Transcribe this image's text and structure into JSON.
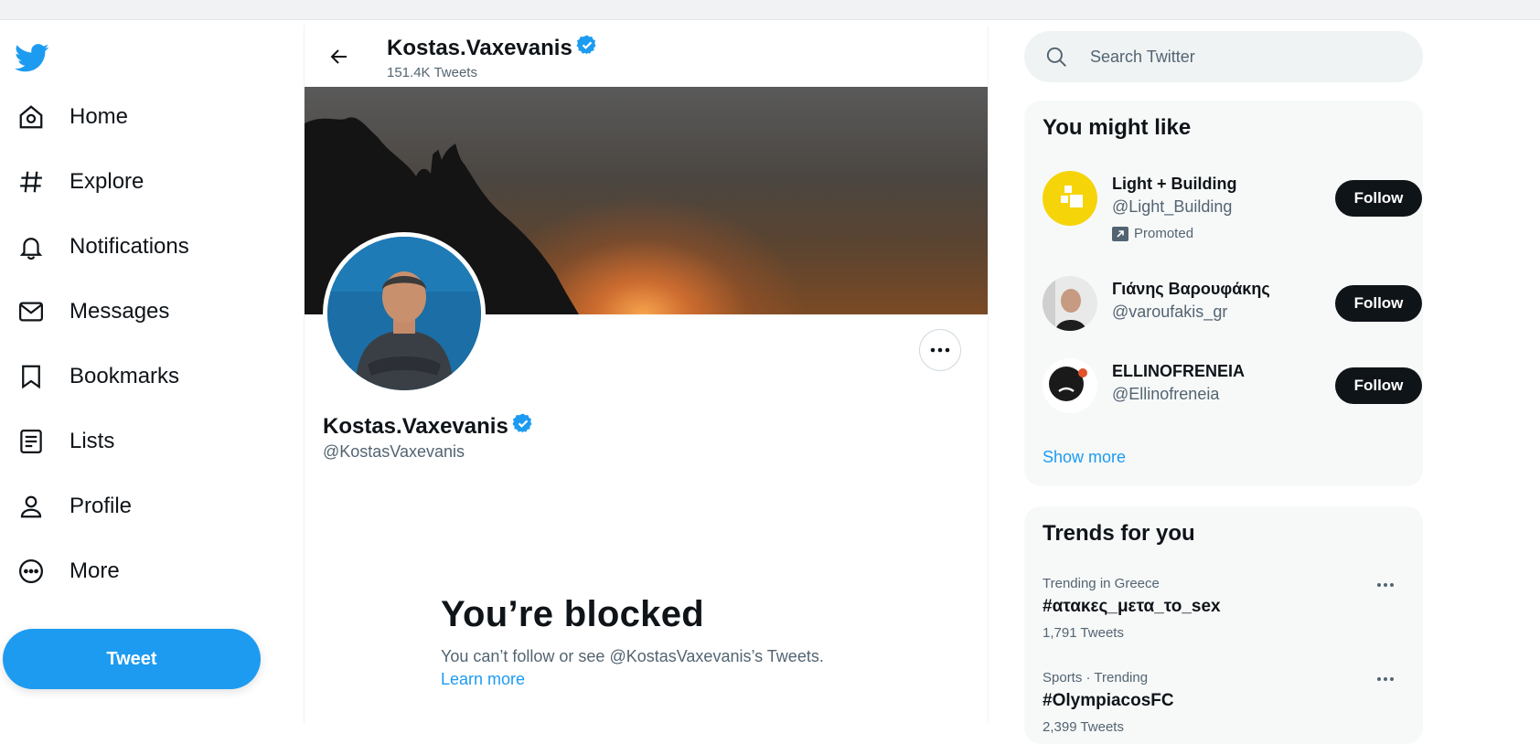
{
  "colors": {
    "accent": "#1d9bf0",
    "text": "#0f1419",
    "secondary": "#536471",
    "panel_bg": "#f7f9f9"
  },
  "nav": {
    "items": [
      {
        "label": "Home",
        "icon": "home-icon"
      },
      {
        "label": "Explore",
        "icon": "hashtag-icon"
      },
      {
        "label": "Notifications",
        "icon": "bell-icon"
      },
      {
        "label": "Messages",
        "icon": "envelope-icon"
      },
      {
        "label": "Bookmarks",
        "icon": "bookmark-icon"
      },
      {
        "label": "Lists",
        "icon": "list-icon"
      },
      {
        "label": "Profile",
        "icon": "person-icon"
      },
      {
        "label": "More",
        "icon": "more-circle-icon"
      }
    ],
    "tweet_label": "Tweet"
  },
  "header": {
    "name": "Kostas.Vaxevanis",
    "tweet_count": "151.4K Tweets"
  },
  "profile": {
    "name": "Kostas.Vaxevanis",
    "handle": "@KostasVaxevanis"
  },
  "blocked": {
    "title": "You’re blocked",
    "text": "You can’t follow or see @KostasVaxevanis’s Tweets.",
    "link": "Learn more"
  },
  "search": {
    "placeholder": "Search Twitter"
  },
  "who_to_follow": {
    "title": "You might like",
    "accounts": [
      {
        "name": "Light + Building",
        "handle": "@Light_Building",
        "promoted": "Promoted",
        "button": "Follow"
      },
      {
        "name": "Γιάνης Βαρουφάκης",
        "handle": "@varoufakis_gr",
        "button": "Follow"
      },
      {
        "name": "ELLINOFRENEIA",
        "handle": "@Ellinofreneia",
        "button": "Follow"
      }
    ],
    "show_more": "Show more"
  },
  "trends": {
    "title": "Trends for you",
    "items": [
      {
        "meta": "Trending in Greece",
        "name": "#ατακες_μετα_το_sex",
        "count": "1,791 Tweets"
      },
      {
        "meta": "Sports · Trending",
        "name": "#OlympiacosFC",
        "count": "2,399 Tweets"
      }
    ]
  }
}
